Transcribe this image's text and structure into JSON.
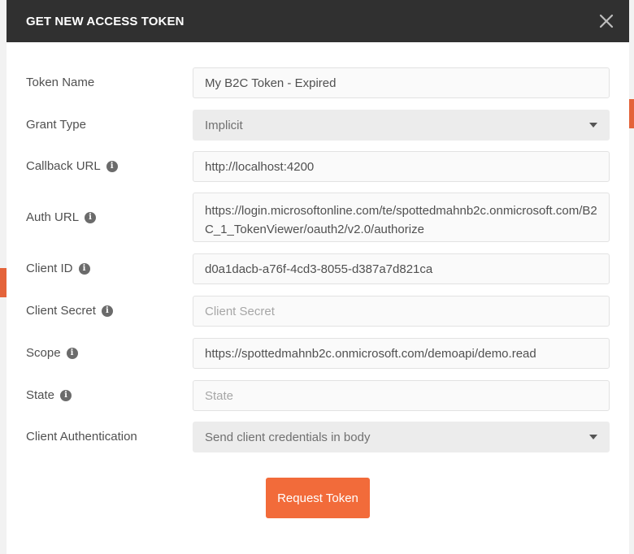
{
  "dialog": {
    "title": "GET NEW ACCESS TOKEN"
  },
  "fields": {
    "token_name": {
      "label": "Token Name",
      "value": "My B2C Token - Expired"
    },
    "grant_type": {
      "label": "Grant Type",
      "value": "Implicit"
    },
    "callback_url": {
      "label": "Callback URL",
      "value": "http://localhost:4200"
    },
    "auth_url": {
      "label": "Auth URL",
      "value": "https://login.microsoftonline.com/te/spottedmahnb2c.onmicrosoft.com/B2C_1_TokenViewer/oauth2/v2.0/authorize"
    },
    "client_id": {
      "label": "Client ID",
      "value": "d0a1dacb-a76f-4cd3-8055-d387a7d821ca"
    },
    "client_secret": {
      "label": "Client Secret",
      "placeholder": "Client Secret"
    },
    "scope": {
      "label": "Scope",
      "value": "https://spottedmahnb2c.onmicrosoft.com/demoapi/demo.read"
    },
    "state": {
      "label": "State",
      "placeholder": "State"
    },
    "client_authentication": {
      "label": "Client Authentication",
      "value": "Send client credentials in body"
    }
  },
  "actions": {
    "request_token": "Request Token"
  },
  "colors": {
    "header": "#303030",
    "accent": "#f26b3a"
  }
}
